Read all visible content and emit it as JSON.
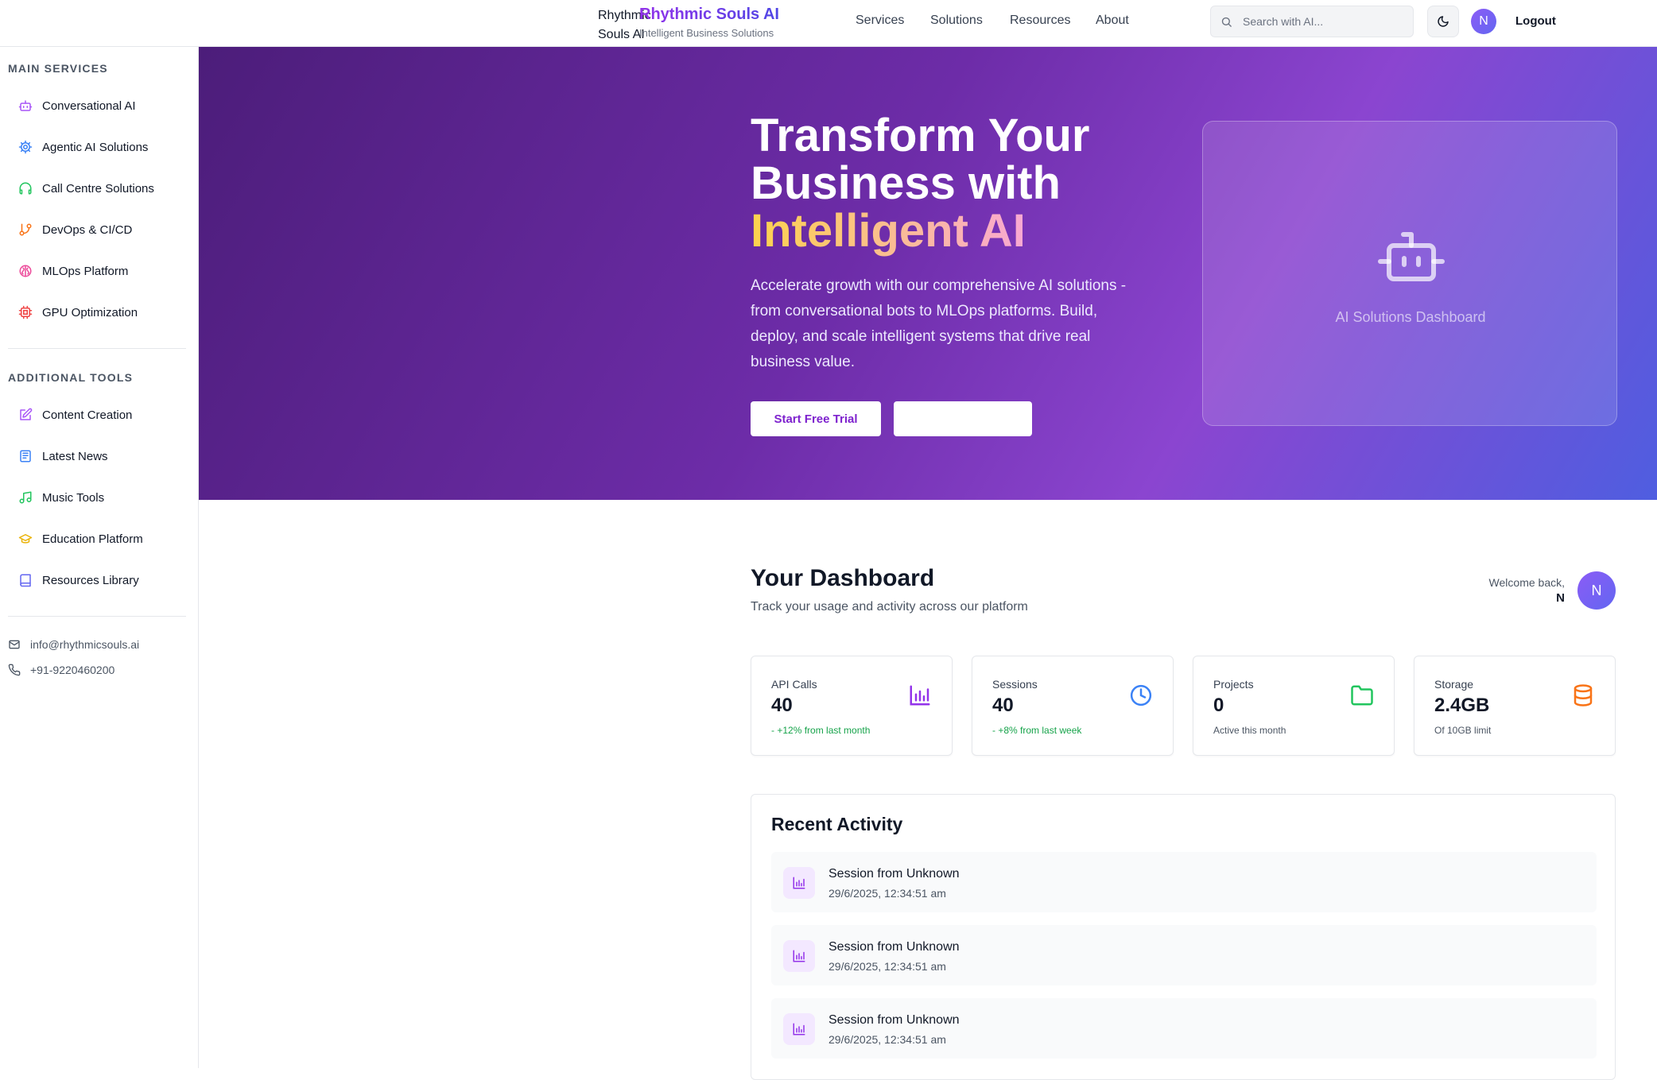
{
  "header": {
    "logo_alt": "Rhythmic Souls AI Logo",
    "brand_name": "Rhythmic Souls AI",
    "brand_tagline": "Intelligent Business Solutions",
    "nav": [
      "Services",
      "Solutions",
      "Resources",
      "About"
    ],
    "search_placeholder": "Search with AI...",
    "avatar_initial": "N",
    "logout_label": "Logout",
    "theme_icon": "moon-icon"
  },
  "sidebar": {
    "main_heading": "MAIN SERVICES",
    "main_items": [
      {
        "label": "Conversational AI",
        "icon": "bot-icon",
        "color": "#a855f7"
      },
      {
        "label": "Agentic AI Solutions",
        "icon": "cog-icon",
        "color": "#3b82f6"
      },
      {
        "label": "Call Centre Solutions",
        "icon": "headphones-icon",
        "color": "#22c55e"
      },
      {
        "label": "DevOps & CI/CD",
        "icon": "git-branch-icon",
        "color": "#f97316"
      },
      {
        "label": "MLOps Platform",
        "icon": "brain-icon",
        "color": "#ec4899"
      },
      {
        "label": "GPU Optimization",
        "icon": "cpu-icon",
        "color": "#ef4444"
      }
    ],
    "tools_heading": "ADDITIONAL TOOLS",
    "tool_items": [
      {
        "label": "Content Creation",
        "icon": "pen-square-icon",
        "color": "#a855f7"
      },
      {
        "label": "Latest News",
        "icon": "newspaper-icon",
        "color": "#3b82f6"
      },
      {
        "label": "Music Tools",
        "icon": "music-icon",
        "color": "#22c55e"
      },
      {
        "label": "Education Platform",
        "icon": "graduation-cap-icon",
        "color": "#eab308"
      },
      {
        "label": "Resources Library",
        "icon": "book-icon",
        "color": "#6366f1"
      }
    ],
    "email": "info@rhythmicsouls.ai",
    "phone": "+91-9220460200"
  },
  "hero": {
    "title_line1": "Transform Your",
    "title_line2": "Business with",
    "title_highlight": "Intelligent AI",
    "description": "Accelerate growth with our comprehensive AI solutions - from conversational bots to MLOps platforms. Build, deploy, and scale intelligent systems that drive real business value.",
    "primary_cta": "Start Free Trial",
    "secondary_cta": "",
    "card_caption": "AI Solutions Dashboard"
  },
  "dashboard": {
    "title": "Your Dashboard",
    "subtitle": "Track your usage and activity across our platform",
    "welcome_label": "Welcome back,",
    "user_name": "N",
    "avatar_initial": "N",
    "stats": [
      {
        "title": "API Calls",
        "value": "40",
        "note": "+12% from last month",
        "trend": true,
        "icon": "bar-chart-icon",
        "color": "#9333ea"
      },
      {
        "title": "Sessions",
        "value": "40",
        "note": "+8% from last week",
        "trend": true,
        "icon": "clock-icon",
        "color": "#3b82f6"
      },
      {
        "title": "Projects",
        "value": "0",
        "note": "Active this month",
        "trend": false,
        "icon": "folder-icon",
        "color": "#22c55e"
      },
      {
        "title": "Storage",
        "value": "2.4GB",
        "note": "Of 10GB limit",
        "trend": false,
        "icon": "database-icon",
        "color": "#f97316"
      }
    ],
    "activity_heading": "Recent Activity",
    "activities": [
      {
        "title": "Session from Unknown",
        "time": "29/6/2025, 12:34:51 am",
        "icon": "bar-chart-icon"
      },
      {
        "title": "Session from Unknown",
        "time": "29/6/2025, 12:34:51 am",
        "icon": "bar-chart-icon"
      },
      {
        "title": "Session from Unknown",
        "time": "29/6/2025, 12:34:51 am",
        "icon": "bar-chart-icon"
      }
    ]
  }
}
